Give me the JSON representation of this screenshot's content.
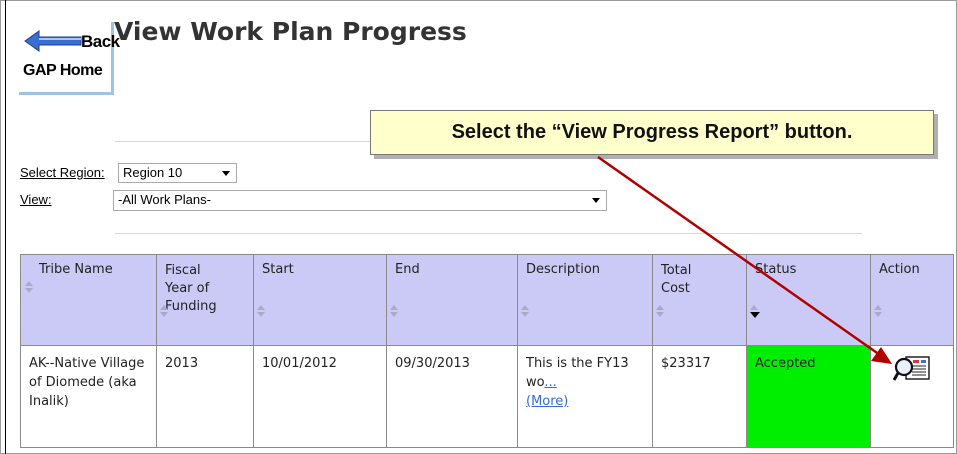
{
  "nav": {
    "back_label": "Back",
    "home_label": "GAP Home"
  },
  "page": {
    "title": "View Work Plan Progress"
  },
  "callout": {
    "text": "Select the “View Progress Report” button."
  },
  "filters": {
    "region_label": "Select Region:",
    "region_value": "Region 10",
    "view_label": "View:",
    "view_value": "-All Work Plans-"
  },
  "table": {
    "headers": [
      "Tribe Name",
      "Fiscal Year of Funding",
      "Start",
      "End",
      "Description",
      "Total Cost",
      "Status",
      "Action"
    ],
    "rows": [
      {
        "tribe_name": "AK--Native Village of Diomede (aka Inalik)",
        "fiscal_year": "2013",
        "start": "10/01/2012",
        "end": "09/30/2013",
        "description": "This is the FY13 wo",
        "description_ellipsis": "...",
        "description_more": "(More)",
        "total_cost": "$23317",
        "status": "Accepted",
        "action_icon": "view-progress-report-icon"
      }
    ]
  },
  "colors": {
    "header_bg": "#cbcaf6",
    "status_accepted": "#00ee00",
    "callout_bg": "#ffffcc",
    "arrow": "#b00000"
  }
}
